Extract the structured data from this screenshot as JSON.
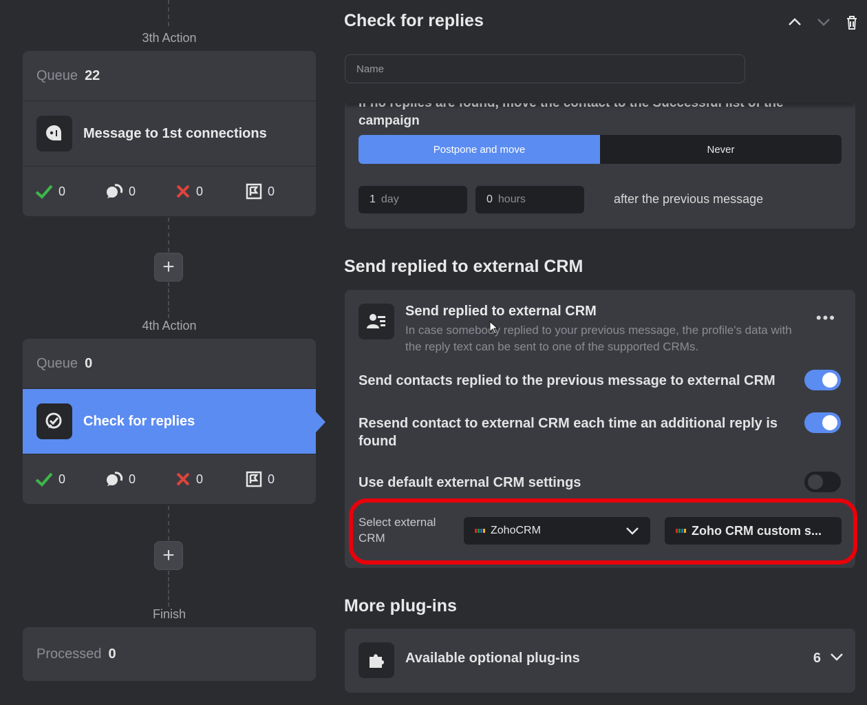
{
  "flow": {
    "actions": [
      {
        "label": "3th Action",
        "queue_label": "Queue",
        "queue_count": "22",
        "step_title": "Message to 1st connections",
        "stats": {
          "success": "0",
          "replied": "0",
          "failed": "0",
          "skipped": "0"
        }
      },
      {
        "label": "4th Action",
        "queue_label": "Queue",
        "queue_count": "0",
        "step_title": "Check for replies",
        "stats": {
          "success": "0",
          "replied": "0",
          "failed": "0",
          "skipped": "0"
        }
      }
    ],
    "add_label": "+",
    "finish_label": "Finish",
    "processed_label": "Processed",
    "processed_count": "0"
  },
  "panel": {
    "title": "Check for replies",
    "name_placeholder": "Name",
    "postpone": {
      "description": "If no replies are found, move the contact to the Successful list of the campaign",
      "options": [
        "Postpone and move",
        "Never"
      ],
      "selected": "Postpone and move",
      "day_value": "1",
      "day_unit": "day",
      "hours_value": "0",
      "hours_unit": "hours",
      "after_text": "after the previous message"
    },
    "crm_section_title": "Send replied to external CRM",
    "crm_card": {
      "title": "Send replied to external CRM",
      "description": "In case somebody replied to your previous message, the profile's data with the reply text can be sent to one of the supported CRMs.",
      "menu": "•••",
      "toggles": [
        {
          "label": "Send contacts replied to the previous message to external CRM",
          "on": true
        },
        {
          "label": "Resend contact to external CRM each time an additional reply is found",
          "on": true
        },
        {
          "label": "Use default external CRM settings",
          "on": false
        }
      ],
      "select_label": "Select external CRM",
      "selected_crm": "ZohoCRM",
      "crm_settings": "Zoho CRM custom s..."
    },
    "plugins_section_title": "More plug-ins",
    "plugins": {
      "title": "Available optional plug-ins",
      "count": "6"
    }
  },
  "colors": {
    "accent": "#5b8cf1",
    "success": "#3db84a",
    "failed": "#e0443a",
    "highlight": "#e8000b"
  }
}
